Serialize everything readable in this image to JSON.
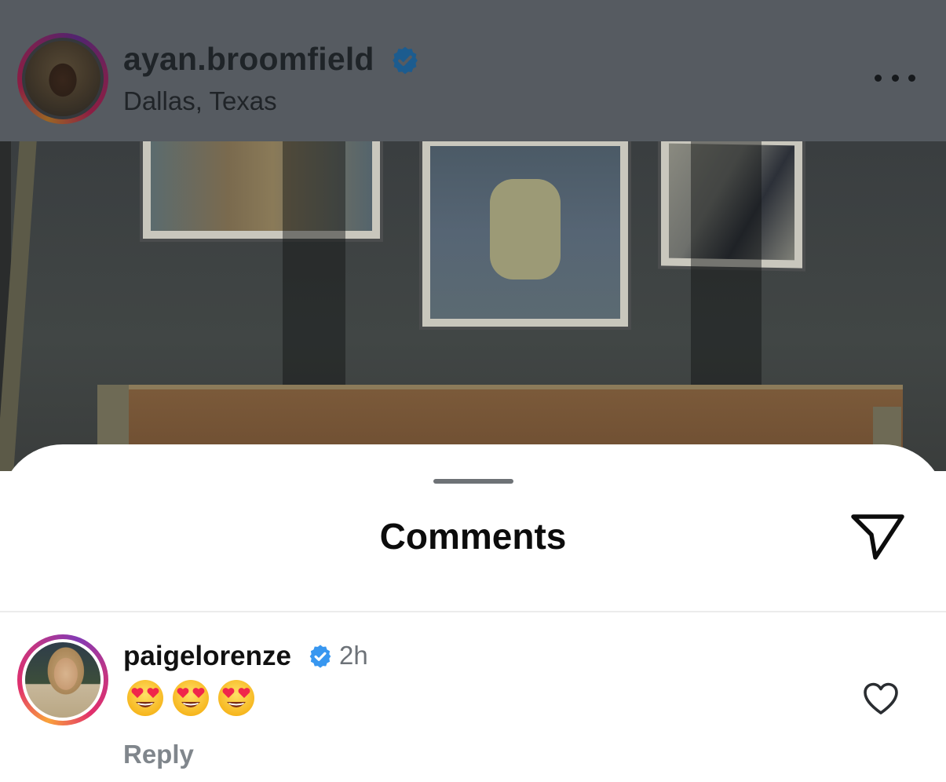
{
  "post_header": {
    "username": "ayan.broomfield",
    "verified": true,
    "location": "Dallas, Texas",
    "more_icon": "ellipsis-horizontal-icon"
  },
  "comments_sheet": {
    "title": "Comments",
    "share_icon": "paper-plane-icon"
  },
  "comments": [
    {
      "username": "paigelorenze",
      "verified": true,
      "time": "2h",
      "text": "😍😍😍",
      "reply_label": "Reply",
      "like_icon": "heart-outline-icon"
    }
  ],
  "colors": {
    "verified_badge_dimmed": "#1c5c8f",
    "verified_badge": "#3897f0",
    "story_ring": [
      "#f9a23b",
      "#e1306c",
      "#833ab4"
    ],
    "overlay": "#565b61"
  }
}
